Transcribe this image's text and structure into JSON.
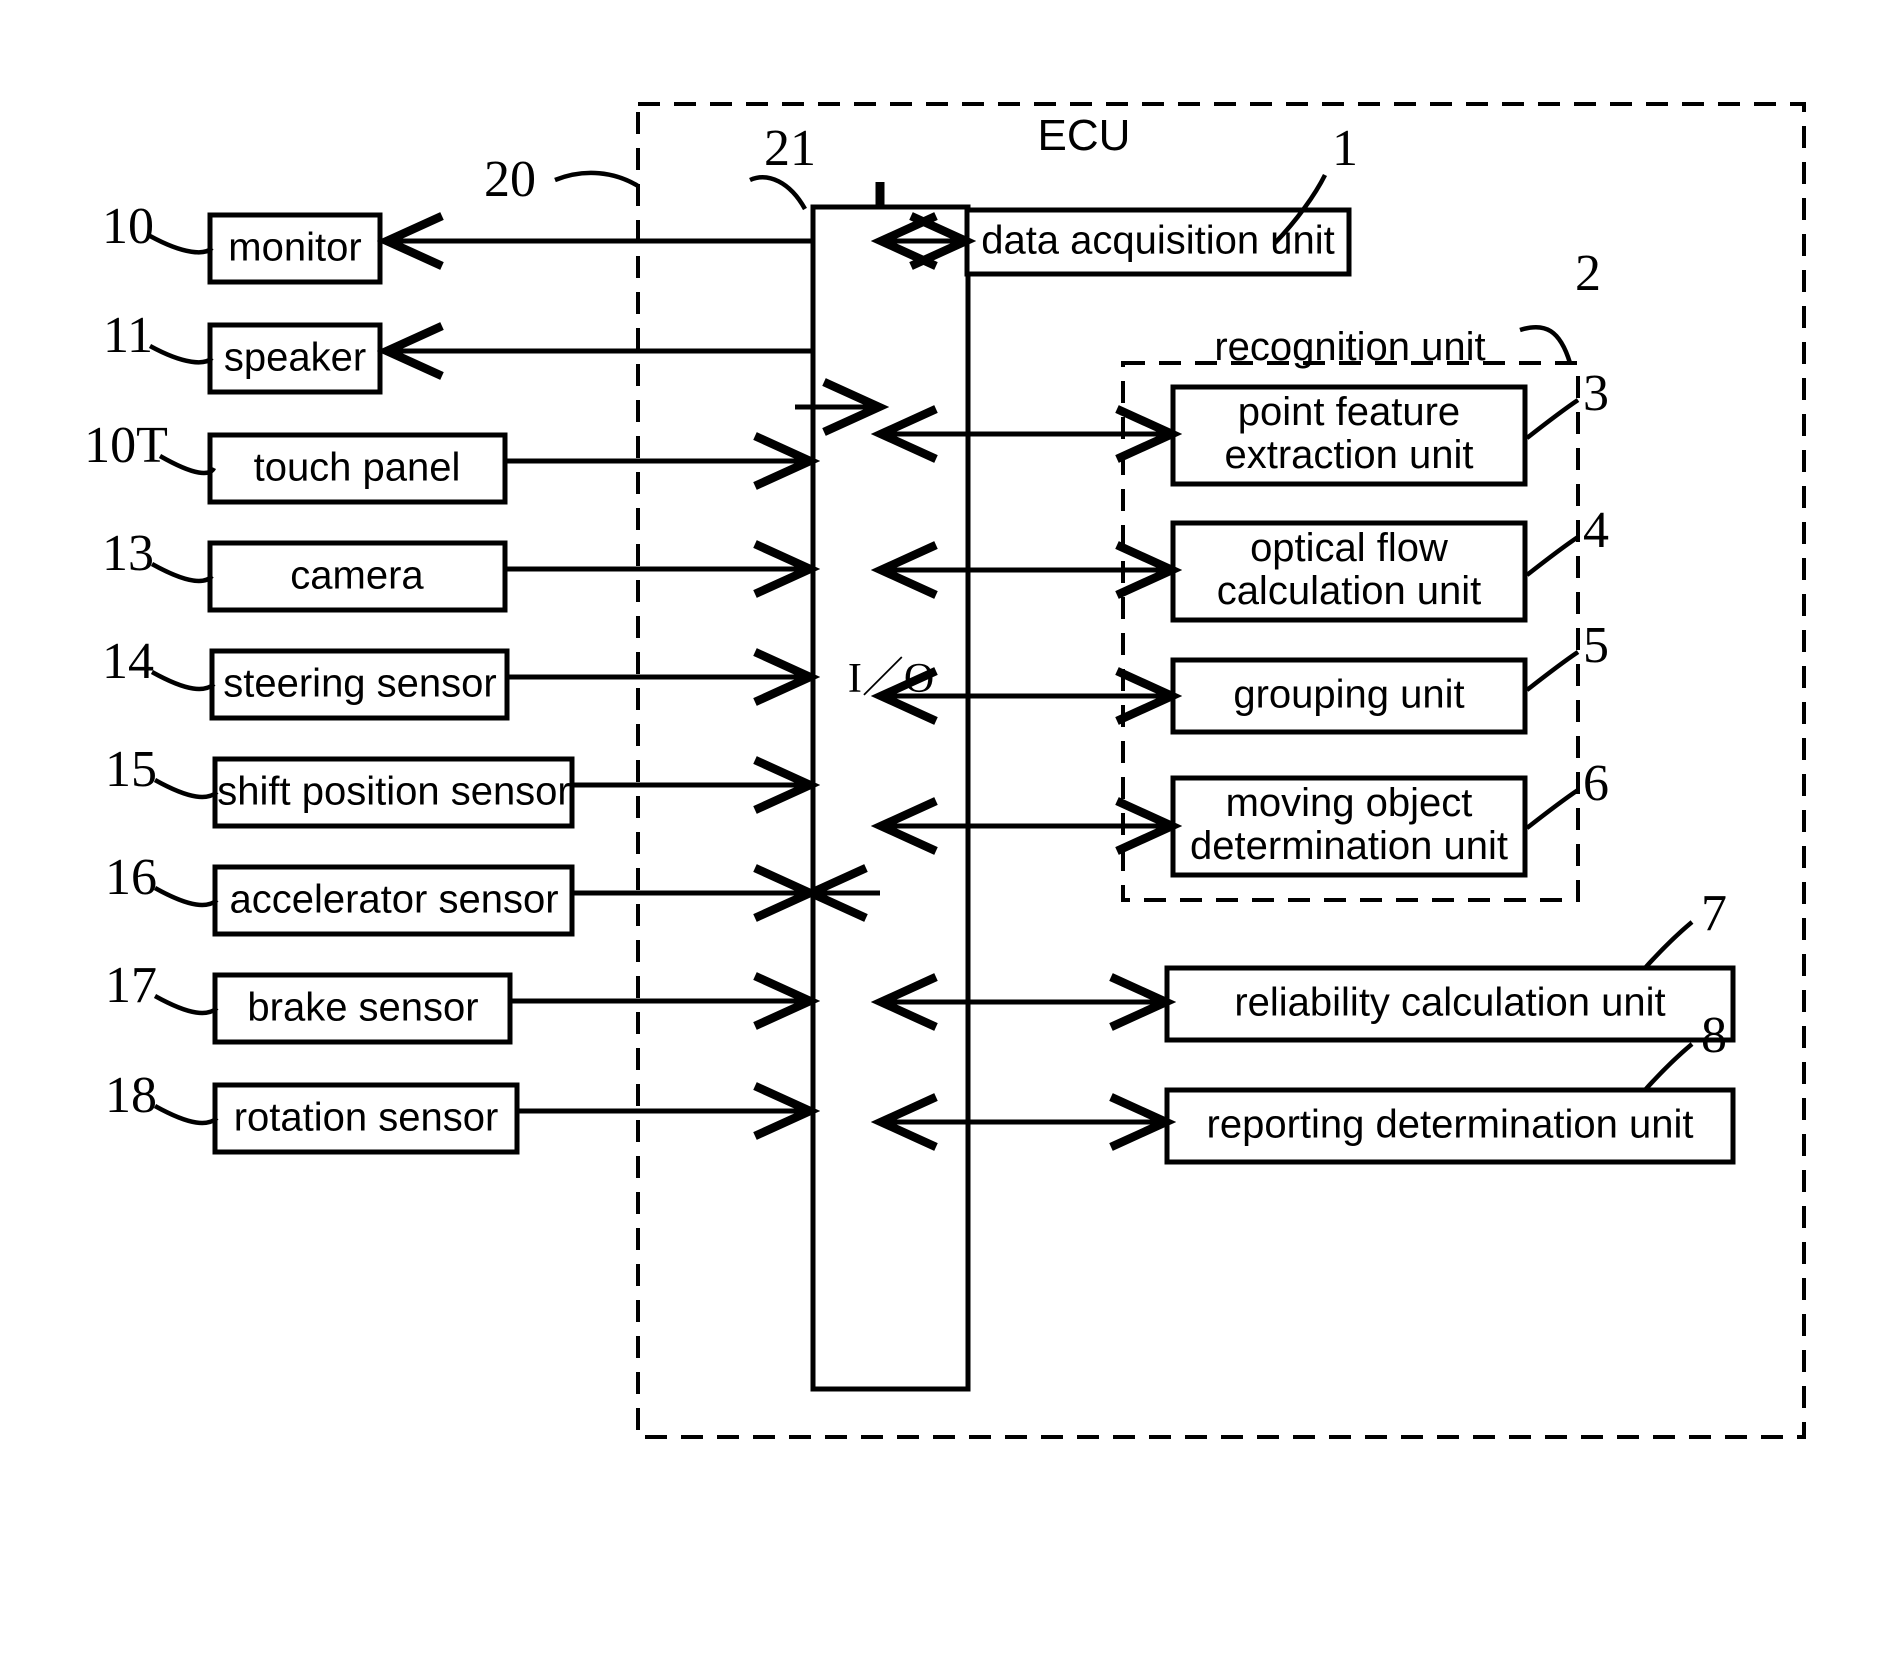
{
  "figure": {
    "ecu_title": "ECU",
    "io_label": "I／O",
    "recognition_group_label": "recognition unit"
  },
  "external_devices": [
    {
      "ref": "10",
      "label": "monitor",
      "direction": "from-ecu"
    },
    {
      "ref": "11",
      "label": "speaker",
      "direction": "from-ecu"
    },
    {
      "ref": "10T",
      "label": "touch panel",
      "direction": "to-ecu"
    },
    {
      "ref": "13",
      "label": "camera",
      "direction": "to-ecu"
    },
    {
      "ref": "14",
      "label": "steering sensor",
      "direction": "to-ecu"
    },
    {
      "ref": "15",
      "label": "shift position sensor",
      "direction": "to-ecu"
    },
    {
      "ref": "16",
      "label": "accelerator sensor",
      "direction": "to-ecu"
    },
    {
      "ref": "17",
      "label": "brake sensor",
      "direction": "to-ecu"
    },
    {
      "ref": "18",
      "label": "rotation sensor",
      "direction": "to-ecu"
    }
  ],
  "ecu_units": [
    {
      "ref": "1",
      "label": "data acquisition unit",
      "line1": "data acquisition unit",
      "line2": ""
    },
    {
      "ref": "3",
      "label": "point feature extraction unit",
      "line1": "point feature",
      "line2": "extraction unit"
    },
    {
      "ref": "4",
      "label": "optical flow calculation unit",
      "line1": "optical flow",
      "line2": "calculation unit"
    },
    {
      "ref": "5",
      "label": "grouping unit",
      "line1": "grouping unit",
      "line2": ""
    },
    {
      "ref": "6",
      "label": "moving object determination unit",
      "line1": "moving object",
      "line2": "determination unit"
    },
    {
      "ref": "7",
      "label": "reliability calculation unit",
      "line1": "reliability calculation unit",
      "line2": ""
    },
    {
      "ref": "8",
      "label": "reporting determination unit",
      "line1": "reporting determination unit",
      "line2": ""
    }
  ],
  "structural_refs": [
    {
      "ref": "20",
      "target": "ecu-outer-boundary"
    },
    {
      "ref": "21",
      "target": "io-interface-block"
    },
    {
      "ref": "2",
      "target": "recognition-unit-group"
    }
  ],
  "colors": {
    "ink": "#000000",
    "paper": "#ffffff"
  }
}
